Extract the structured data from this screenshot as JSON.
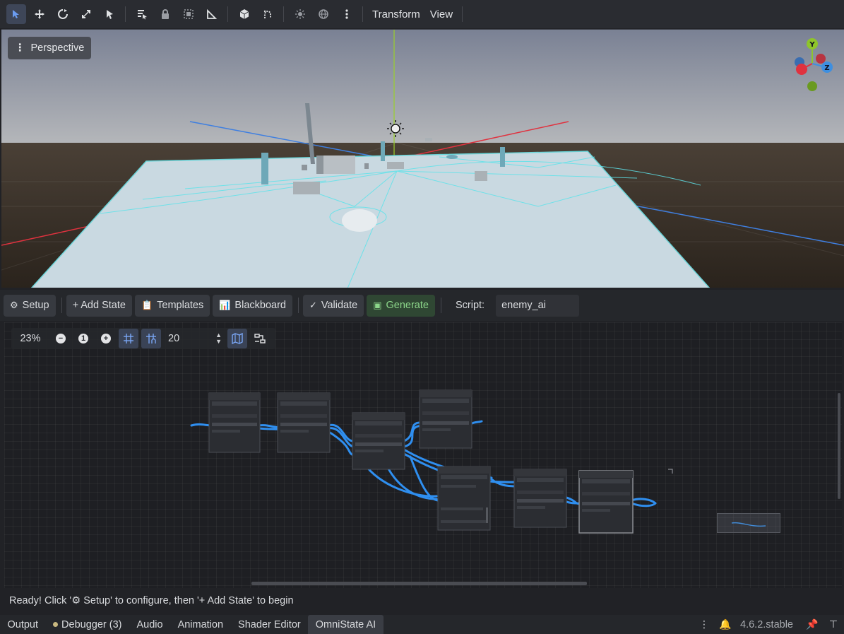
{
  "toolbar": {
    "icons": [
      "select-icon",
      "move-icon",
      "rotate-icon",
      "scale-icon",
      "pointer-icon",
      "list-select-icon",
      "lock-icon",
      "group-icon",
      "ruler-icon",
      "local-space-icon",
      "snap-icon",
      "sun-icon",
      "environment-icon",
      "more-icon"
    ],
    "menus": {
      "transform": "Transform",
      "view": "View"
    }
  },
  "viewport": {
    "perspective_label": "Perspective",
    "gizmo": {
      "y_label": "Y",
      "z_label": "Z",
      "colors": {
        "x": "#e0323f",
        "y": "#8ec52a",
        "z": "#3e8fe0"
      }
    }
  },
  "panel": {
    "setup_label": "Setup",
    "add_state_label": "+ Add State",
    "templates_label": "Templates",
    "blackboard_label": "Blackboard",
    "validate_label": "Validate",
    "generate_label": "Generate",
    "script_label": "Script:",
    "script_value": "enemy_ai"
  },
  "graph": {
    "zoom": "23%",
    "snap_distance": "20",
    "connection_color": "#2f8ff0"
  },
  "status": {
    "part1": "Ready! Click '",
    "part2": " Setup' to configure, then '+ Add State' to begin"
  },
  "bottom_tabs": {
    "output": "Output",
    "debugger": "Debugger (3)",
    "audio": "Audio",
    "animation": "Animation",
    "shader_editor": "Shader Editor",
    "omnistate": "OmniState AI"
  },
  "version": "4.6.2.stable"
}
